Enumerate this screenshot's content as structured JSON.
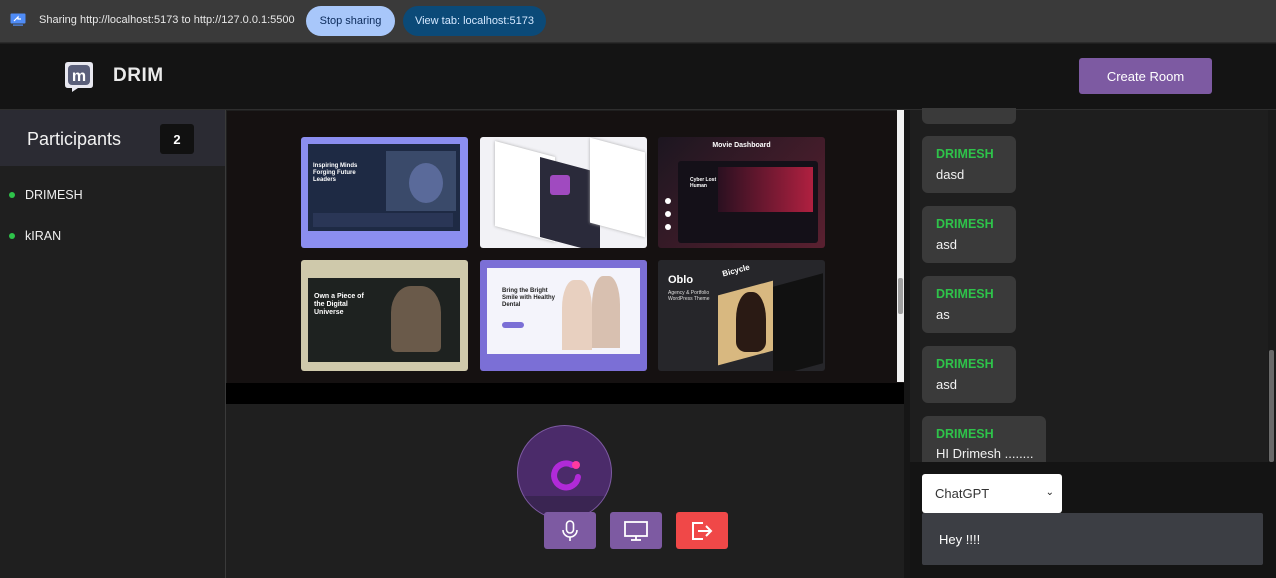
{
  "browser_bar": {
    "sharing_text": "Sharing http://localhost:5173 to http://127.0.0.1:5500",
    "stop_label": "Stop sharing",
    "view_tab_label": "View tab: localhost:5173"
  },
  "header": {
    "logo_letter": "m",
    "brand": "DRIM",
    "create_room_label": "Create Room"
  },
  "participants": {
    "title": "Participants",
    "count": "2",
    "list": [
      {
        "name": "DRIMESH"
      },
      {
        "name": "kIRAN"
      }
    ]
  },
  "shared_screen": {
    "thumbs": [
      {
        "headline": "Inspiring Minds Forging Future Leaders",
        "bg": "#7b7de6"
      },
      {
        "headline": "",
        "bg": "#f2f2f6"
      },
      {
        "headline": "Movie Dashboard",
        "sub": "Cyber Lost Human",
        "bg": "#3a1f2a"
      },
      {
        "headline": "Own a Piece of the Digital Universe",
        "bg": "#c9c3a4"
      },
      {
        "headline": "Bring the Bright Smile with Healthy Dental",
        "bg": "#7b6fd6"
      },
      {
        "headline": "Oblo",
        "sub": "Agency & Portfolio WordPress Theme",
        "extra": "Bicycle",
        "bg": "#2a2a2e"
      }
    ]
  },
  "controls": {
    "mic_icon": "microphone-icon",
    "screen_icon": "monitor-icon",
    "leave_icon": "exit-icon"
  },
  "chat": {
    "messages": [
      {
        "name": "DRIMESH",
        "text": "dasd"
      },
      {
        "name": "DRIMESH",
        "text": "asd"
      },
      {
        "name": "DRIMESH",
        "text": "as"
      },
      {
        "name": "DRIMESH",
        "text": "asd"
      },
      {
        "name": "DRIMESH",
        "text": "HI Drimesh ........"
      }
    ],
    "model_select": "ChatGPT",
    "input_value": "Hey !!!!"
  },
  "colors": {
    "accent": "#7d5aa2",
    "online": "#2ec34a",
    "leave": "#f04848"
  }
}
